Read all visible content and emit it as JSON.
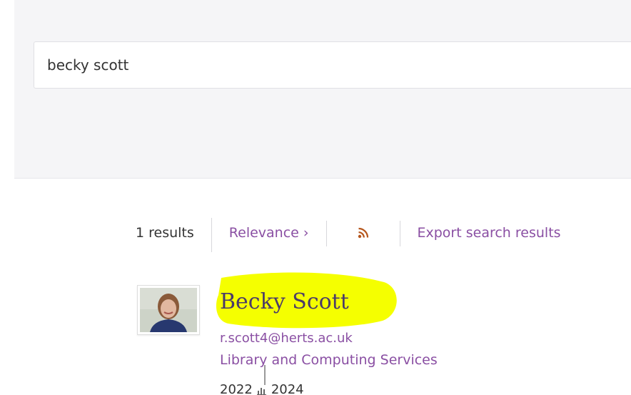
{
  "search": {
    "query": "becky scott"
  },
  "toolbar": {
    "results_count": "1 results",
    "sort_label": "Relevance ›",
    "rss_icon": "rss-icon",
    "export_label": "Export search results"
  },
  "result": {
    "name": "Becky Scott",
    "email": "r.scott4@herts.ac.uk",
    "organisation": "Library and Computing Services",
    "year_start": "2022",
    "year_end": "2024"
  },
  "colors": {
    "link": "#8a4fa3",
    "name": "#4a3a6a",
    "highlight": "#f5ff00",
    "rss": "#b5561c"
  }
}
